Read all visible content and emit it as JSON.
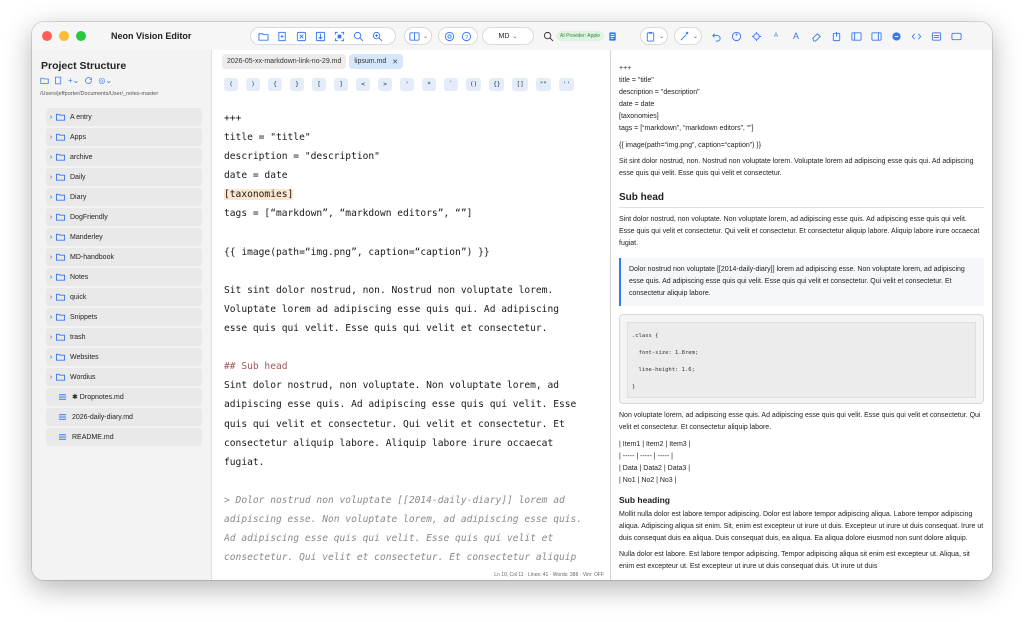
{
  "window": {
    "title": "Neon Vision Editor"
  },
  "toolbar": {
    "mode_label": "MD",
    "ai_badge": "AI Provider: Apple",
    "font_small": "A",
    "font_large": "A"
  },
  "sidebar": {
    "title": "Project Structure",
    "path": "/Users/jeffporter/Documents/User/_notes-master",
    "folders": [
      "A entry",
      "Apps",
      "archive",
      "Daily",
      "Diary",
      "DogFriendly",
      "Manderley",
      "MD-handbook",
      "Notes",
      "quick",
      "Snippets",
      "trash",
      "Websites",
      "Wordius"
    ],
    "files": [
      "✱ Dropnotes.md",
      "2026-daily-diary.md",
      "README.md"
    ]
  },
  "editor": {
    "tabs": [
      {
        "label": "2026-05-xx-markdown-link-no-29.md",
        "active": false
      },
      {
        "label": "lipsum.md",
        "active": true
      }
    ],
    "snippets": [
      "(",
      ")",
      "{",
      "}",
      "[",
      "]",
      "<",
      ">",
      "'",
      "*",
      "`",
      "()",
      "{}",
      "[]",
      "\"\"",
      "''"
    ],
    "lines": {
      "l1": "+++",
      "l2": "title = \"title\"",
      "l3": "description = \"description\"",
      "l4": "date = date",
      "l5": "[taxonomies]",
      "l6": "tags = [“markdown”, “markdown editors”, “”]",
      "l7": "",
      "l8": "{{ image(path=“img.png”, caption=“caption”) }}",
      "l9": "",
      "l10": "Sit sint dolor nostrud, non. Nostrud non voluptate lorem.",
      "l11": "Voluptate lorem ad adipiscing esse quis qui. Ad adipiscing",
      "l12": "esse quis qui velit. Esse quis qui velit et consectetur.",
      "l13": "",
      "l14": "## Sub head",
      "l15": "Sint dolor nostrud, non voluptate. Non voluptate lorem, ad",
      "l16": "adipiscing esse quis. Ad adipiscing esse quis qui velit. Esse",
      "l17": "quis qui velit et consectetur. Qui velit et consectetur. Et",
      "l18": "consectetur aliquip labore. Aliquip labore irure occaecat",
      "l19": "fugiat.",
      "l20": "",
      "l21": "> Dolor nostrud non voluptate [[2014-daily-diary]] lorem ad",
      "l22": "adipiscing esse. Non voluptate lorem, ad adipiscing esse quis.",
      "l23": "Ad adipiscing esse quis qui velit. Esse quis qui velit et",
      "l24": "consectetur. Qui velit et consectetur. Et consectetur aliquip"
    },
    "status": "Ln 10, Col 11 · Lines: 41 · Words: 388 · Vim: OFF"
  },
  "preview": {
    "front": [
      "+++",
      "title = \"title\"",
      "description = \"description\"",
      "date = date",
      "[taxonomies]",
      "tags = [“markdown”, “markdown editors”, “”]"
    ],
    "image_line": "{{ image(path=“img.png”, caption=“caption”) }}",
    "para1": "Sit sint dolor nostrud, non. Nostrud non voluptate lorem. Voluptate lorem ad adipiscing esse quis qui. Ad adipiscing esse quis qui velit. Esse quis qui velit et consectetur.",
    "h2": "Sub head",
    "para2": "Sint dolor nostrud, non voluptate. Non voluptate lorem, ad adipiscing esse quis. Ad adipiscing esse quis qui velit. Esse quis qui velit et consectetur. Qui velit et consectetur. Et consectetur aliquip labore. Aliquip labore irure occaecat fugiat.",
    "quote": "Dolor nostrud non voluptate [[2014-daily-diary]] lorem ad adipiscing esse. Non voluptate lorem, ad adipiscing esse quis. Ad adipiscing esse quis qui velit. Esse quis qui velit et consectetur. Qui velit et consectetur. Et consectetur aliquip labore.",
    "code": [
      ".class {",
      "  font-size: 1.8rem;",
      "  line-height: 1.6;",
      "}"
    ],
    "para3": "Non voluptate lorem, ad adipiscing esse quis. Ad adipiscing esse quis qui velit. Esse quis qui velit et consectetur. Qui velit et consectetur. Et consectetur aliquip labore.",
    "table": [
      "| Item1 | Item2 | Item3 |",
      "| ----- | ----- | ----- |",
      "| Data | Data2 | Data3 |",
      "| No1 | No2 | No3 |"
    ],
    "h3": "Sub heading",
    "para4": "Mollit nulla dolor est labore tempor adipiscing. Dolor est labore tempor adipiscing aliqua. Labore tempor adipiscing aliqua. Adipiscing aliqua sit enim. Sit, enim est excepteur ut irure ut duis. Excepteur ut irure ut duis consequat. Irure ut duis consequat duis ea aliqua. Duis consequat duis, ea aliqua. Ea aliqua dolore eiusmod non sunt dolore aliquip.",
    "para5": "Nulla dolor est labore. Est labore tempor adipiscing. Tempor adipiscing aliqua sit enim est excepteur ut. Aliqua, sit enim est excepteur ut. Est excepteur ut irure ut duis consequat duis. Ut irure ut duis"
  }
}
